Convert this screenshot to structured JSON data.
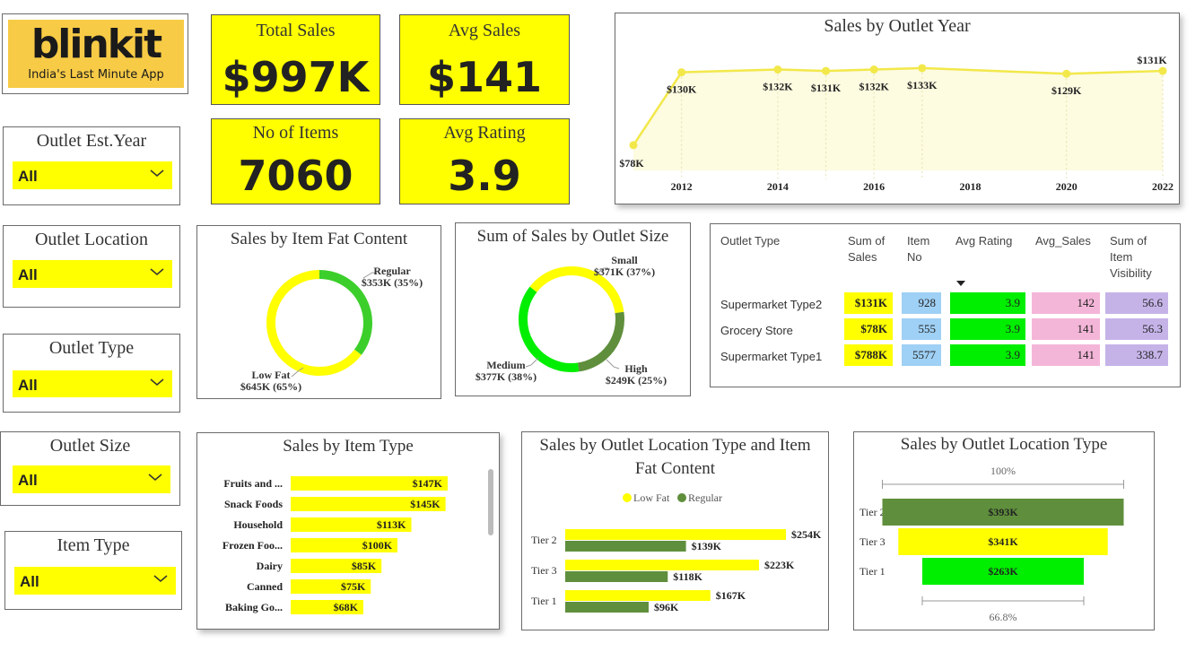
{
  "logo": {
    "brand": "blinkit",
    "tagline": "India's Last Minute App",
    "color": "#f8cb46"
  },
  "kpis": {
    "total_sales": {
      "label": "Total Sales",
      "value": "$997K"
    },
    "avg_sales": {
      "label": "Avg Sales",
      "value": "$141"
    },
    "num_items": {
      "label": "No of Items",
      "value": "7060"
    },
    "avg_rating": {
      "label": "Avg Rating",
      "value": "3.9"
    }
  },
  "slicers": {
    "est_year": {
      "label": "Outlet Est.Year",
      "value": "All"
    },
    "location": {
      "label": "Outlet Location",
      "value": "All"
    },
    "outlet_type": {
      "label": "Outlet Type",
      "value": "All"
    },
    "outlet_size": {
      "label": "Outlet Size",
      "value": "All"
    },
    "item_type": {
      "label": "Item Type",
      "value": "All"
    }
  },
  "colors": {
    "yellow": "#ffff00",
    "green_bright": "#00ee00",
    "green_mid": "#3ccf2b",
    "green_dark": "#5f8f3c",
    "blue": "#9fd0f5",
    "pink": "#f4b6d8",
    "purple": "#c5b3e8",
    "line": "#f2e84a"
  },
  "chart_data": [
    {
      "type": "area",
      "title": "Sales by Outlet Year",
      "x": [
        2011,
        2012,
        2014,
        2015,
        2016,
        2017,
        2020,
        2022
      ],
      "values": [
        78,
        130,
        132,
        131,
        132,
        133,
        129,
        131
      ],
      "data_labels": [
        "$78K",
        "$130K",
        "$132K",
        "$131K",
        "$132K",
        "$133K",
        "$129K",
        "$131K"
      ],
      "x_ticks": [
        "2012",
        "2014",
        "2016",
        "2018",
        "2020",
        "2022"
      ]
    },
    {
      "type": "pie",
      "title": "Sales by Item Fat Content",
      "slices": [
        {
          "name": "Regular",
          "value": 353,
          "label": "$353K (35%)",
          "color": "#3ccf2b"
        },
        {
          "name": "Low Fat",
          "value": 645,
          "label": "$645K (65%)",
          "color": "#ffff00"
        }
      ]
    },
    {
      "type": "pie",
      "title": "Sum of Sales by Outlet Size",
      "slices": [
        {
          "name": "Small",
          "value": 371,
          "label": "$371K (37%)",
          "color": "#ffff00"
        },
        {
          "name": "High",
          "value": 249,
          "label": "$249K (25%)",
          "color": "#5f8f3c"
        },
        {
          "name": "Medium",
          "value": 377,
          "label": "$377K (38%)",
          "color": "#00ee00"
        }
      ]
    },
    {
      "type": "table",
      "columns": [
        "Outlet Type",
        "Sum of Sales",
        "Item No",
        "Avg Rating",
        "Avg_Sales",
        "Sum of Item Visibility"
      ],
      "rows": [
        [
          "Supermarket Type2",
          "$131K",
          "928",
          "3.9",
          "142",
          "56.6"
        ],
        [
          "Grocery Store",
          "$78K",
          "555",
          "3.9",
          "141",
          "56.3"
        ],
        [
          "Supermarket Type1",
          "$788K",
          "5577",
          "3.9",
          "141",
          "338.7"
        ]
      ]
    },
    {
      "type": "bar",
      "title": "Sales by Item Type",
      "categories": [
        "Fruits and ...",
        "Snack Foods",
        "Household",
        "Frozen Foo...",
        "Dairy",
        "Canned",
        "Baking Go..."
      ],
      "values": [
        147,
        145,
        113,
        100,
        85,
        75,
        68
      ],
      "data_labels": [
        "$147K",
        "$145K",
        "$113K",
        "$100K",
        "$85K",
        "$75K",
        "$68K"
      ]
    },
    {
      "type": "bar",
      "title": "Sales by Outlet Location Type and Item Fat Content",
      "categories": [
        "Tier 2",
        "Tier 3",
        "Tier 1"
      ],
      "series": [
        {
          "name": "Low Fat",
          "values": [
            254,
            223,
            167
          ],
          "labels": [
            "$254K",
            "$223K",
            "$167K"
          ]
        },
        {
          "name": "Regular",
          "values": [
            139,
            118,
            96
          ],
          "labels": [
            "$139K",
            "$118K",
            "$96K"
          ]
        }
      ]
    },
    {
      "type": "bar",
      "title": "Sales by Outlet Location Type",
      "categories": [
        "Tier 2",
        "Tier 3",
        "Tier 1"
      ],
      "values": [
        393,
        341,
        263
      ],
      "data_labels": [
        "$393K",
        "$341K",
        "$263K"
      ],
      "top_label": "100%",
      "bottom_label": "66.8%"
    }
  ]
}
